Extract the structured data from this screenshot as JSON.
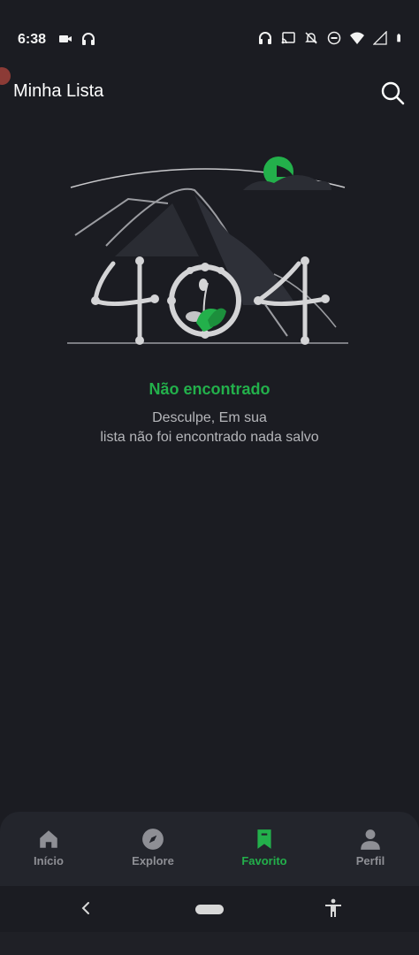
{
  "status_bar": {
    "time": "6:38",
    "left_icons": [
      "camera-icon",
      "headphones-icon"
    ],
    "right_icons": [
      "headset-icon",
      "cast-icon",
      "notifications-off-icon",
      "do-not-disturb-icon",
      "wifi-icon",
      "signal-icon",
      "battery-icon"
    ]
  },
  "app_bar": {
    "title": "Minha Lista",
    "search_icon": "search-icon"
  },
  "empty_state": {
    "title": "Não encontrado",
    "message_line1": "Desculpe, Em sua",
    "message_line2": "lista não foi encontrado nada salvo",
    "accent_color": "#23b04b"
  },
  "bottom_nav": {
    "items": [
      {
        "label": "Início",
        "icon": "home-icon",
        "active": false
      },
      {
        "label": "Explore",
        "icon": "compass-icon",
        "active": false
      },
      {
        "label": "Favorito",
        "icon": "bookmark-icon",
        "active": true
      },
      {
        "label": "Perfil",
        "icon": "person-icon",
        "active": false
      }
    ],
    "active_color": "#23b04b",
    "inactive_color": "#8e8f95"
  },
  "system_nav": {
    "icons": [
      "back-icon",
      "home-pill",
      "accessibility-icon"
    ]
  }
}
